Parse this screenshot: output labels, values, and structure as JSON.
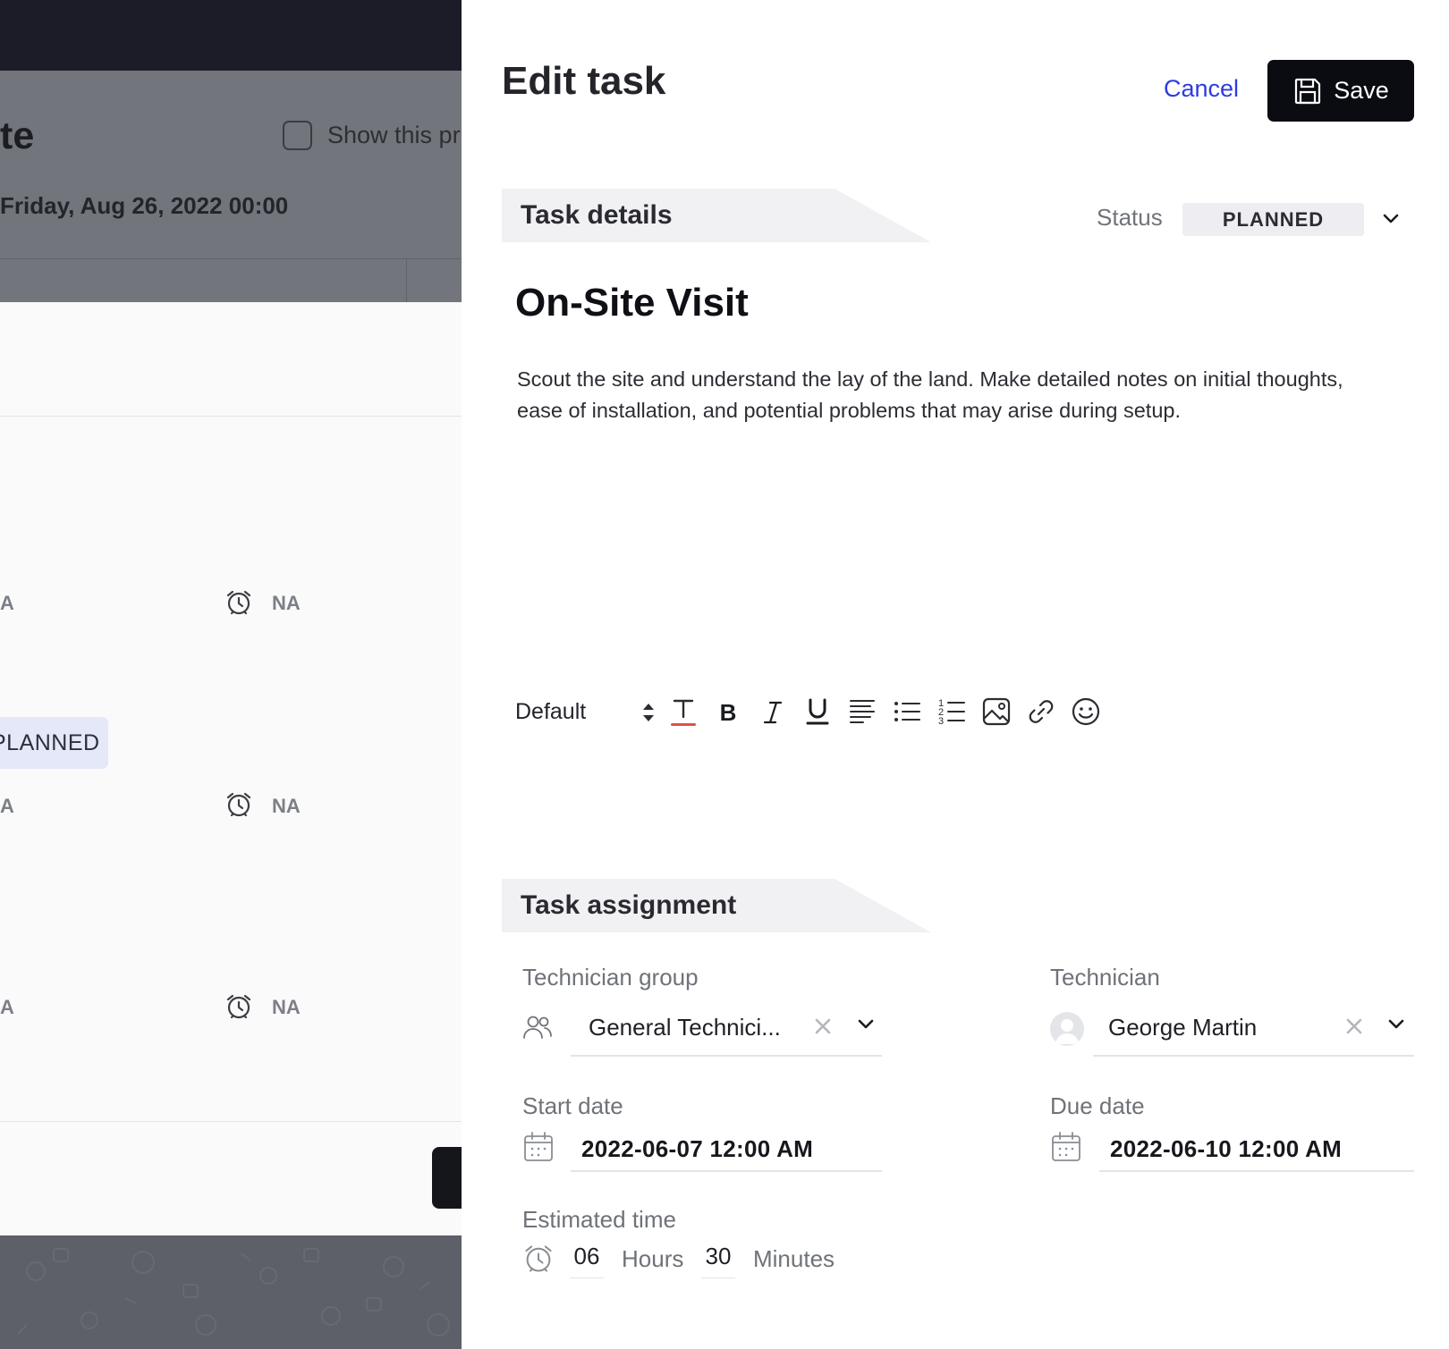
{
  "background": {
    "page_title_fragment": "te",
    "show_checkbox_label": "Show this pr",
    "date_line": "Friday, Aug 26, 2022 00:00",
    "rows": [
      {
        "left_value": "A",
        "alarm_value": "NA"
      },
      {
        "left_value": "A",
        "alarm_value": "NA"
      },
      {
        "left_value": "A",
        "alarm_value": "NA"
      }
    ],
    "status_pill": "PLANNED"
  },
  "drawer": {
    "title": "Edit task",
    "cancel_label": "Cancel",
    "save_label": "Save",
    "details_section": "Task details",
    "status_label": "Status",
    "status_value": "PLANNED",
    "task_name": "On-Site Visit",
    "task_description": "Scout the site and understand the lay of the land. Make detailed notes on initial thoughts, ease of installation, and potential problems that may arise during setup.",
    "toolbar": {
      "font_style": "Default",
      "tools": [
        "text-color",
        "bold",
        "italic",
        "underline",
        "align",
        "bullet-list",
        "numbered-list",
        "image",
        "link",
        "emoji"
      ]
    },
    "assignment_section": "Task assignment",
    "technician_group": {
      "label": "Technician group",
      "value": "General Technici..."
    },
    "technician": {
      "label": "Technician",
      "value": "George Martin"
    },
    "start_date": {
      "label": "Start date",
      "value": "2022-06-07 12:00 AM"
    },
    "due_date": {
      "label": "Due date",
      "value": "2022-06-10 12:00 AM"
    },
    "estimated_time": {
      "label": "Estimated time",
      "hours": "06",
      "hours_unit": "Hours",
      "minutes": "30",
      "minutes_unit": "Minutes"
    }
  },
  "colors": {
    "accent_link": "#2d3be0",
    "primary_button": "#0b0b12",
    "status_pill_bg": "#eeeef2",
    "section_band": "#f1f1f4",
    "text_color_underline": "#e0504a"
  }
}
